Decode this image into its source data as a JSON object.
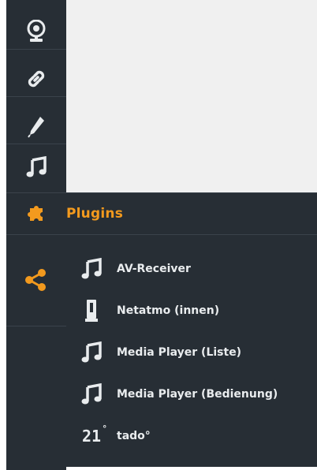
{
  "sidebar": {
    "items": [
      {
        "icon": "webcam-icon"
      },
      {
        "icon": "link-icon"
      },
      {
        "icon": "pen-icon"
      },
      {
        "icon": "music-note-icon"
      }
    ]
  },
  "plugins": {
    "title": "Plugins",
    "header_icon": "puzzle-icon",
    "side_icon": "share-icon",
    "accent_color": "#f39a1e"
  },
  "menu": {
    "items": [
      {
        "label": "AV-Receiver",
        "icon": "music-note-icon"
      },
      {
        "label": "Netatmo (innen)",
        "icon": "sensor-icon"
      },
      {
        "label": "Media Player (Liste)",
        "icon": "music-note-icon"
      },
      {
        "label": "Media Player (Bedienung)",
        "icon": "music-note-icon"
      },
      {
        "label": "tado°",
        "icon": "thermostat-icon",
        "icon_text": "21",
        "icon_sup": "°"
      }
    ]
  }
}
